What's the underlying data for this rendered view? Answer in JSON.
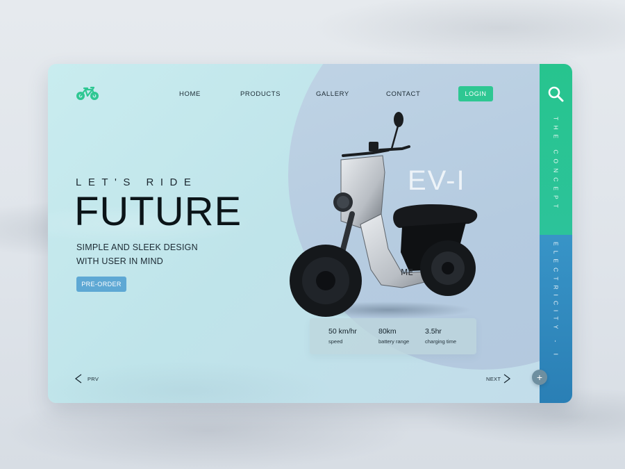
{
  "nav": {
    "items": [
      {
        "label": "HOME"
      },
      {
        "label": "PRODUCTS"
      },
      {
        "label": "GALLERY"
      },
      {
        "label": "CONTACT"
      }
    ],
    "login_label": "LOGIN",
    "logo_icon": "bicycle-icon"
  },
  "sidebar": {
    "search_icon": "search-icon",
    "top_label": "THE CONCEPT",
    "bottom_label": "ELECTRICITY - I"
  },
  "hero": {
    "tagline": "LET'S RIDE",
    "headline": "FUTURE",
    "subtitle_line1": "SIMPLE AND SLEEK DESIGN",
    "subtitle_line2": "WITH USER IN MIND",
    "cta_label": "PRE-ORDER"
  },
  "product": {
    "model_name": "EV-I",
    "brand_mark": "ME",
    "specs": [
      {
        "value": "50 km/hr",
        "label": "speed"
      },
      {
        "value": "80km",
        "label": "battery range"
      },
      {
        "value": "3.5hr",
        "label": "charging time"
      }
    ]
  },
  "pager": {
    "prev_label": "PRV",
    "next_label": "NEXT",
    "plus_symbol": "+"
  },
  "colors": {
    "accent_green": "#2ec792",
    "accent_blue": "#2a7fb5",
    "preorder_blue": "#5ea8d4",
    "card_bg": "#c9ecef"
  }
}
